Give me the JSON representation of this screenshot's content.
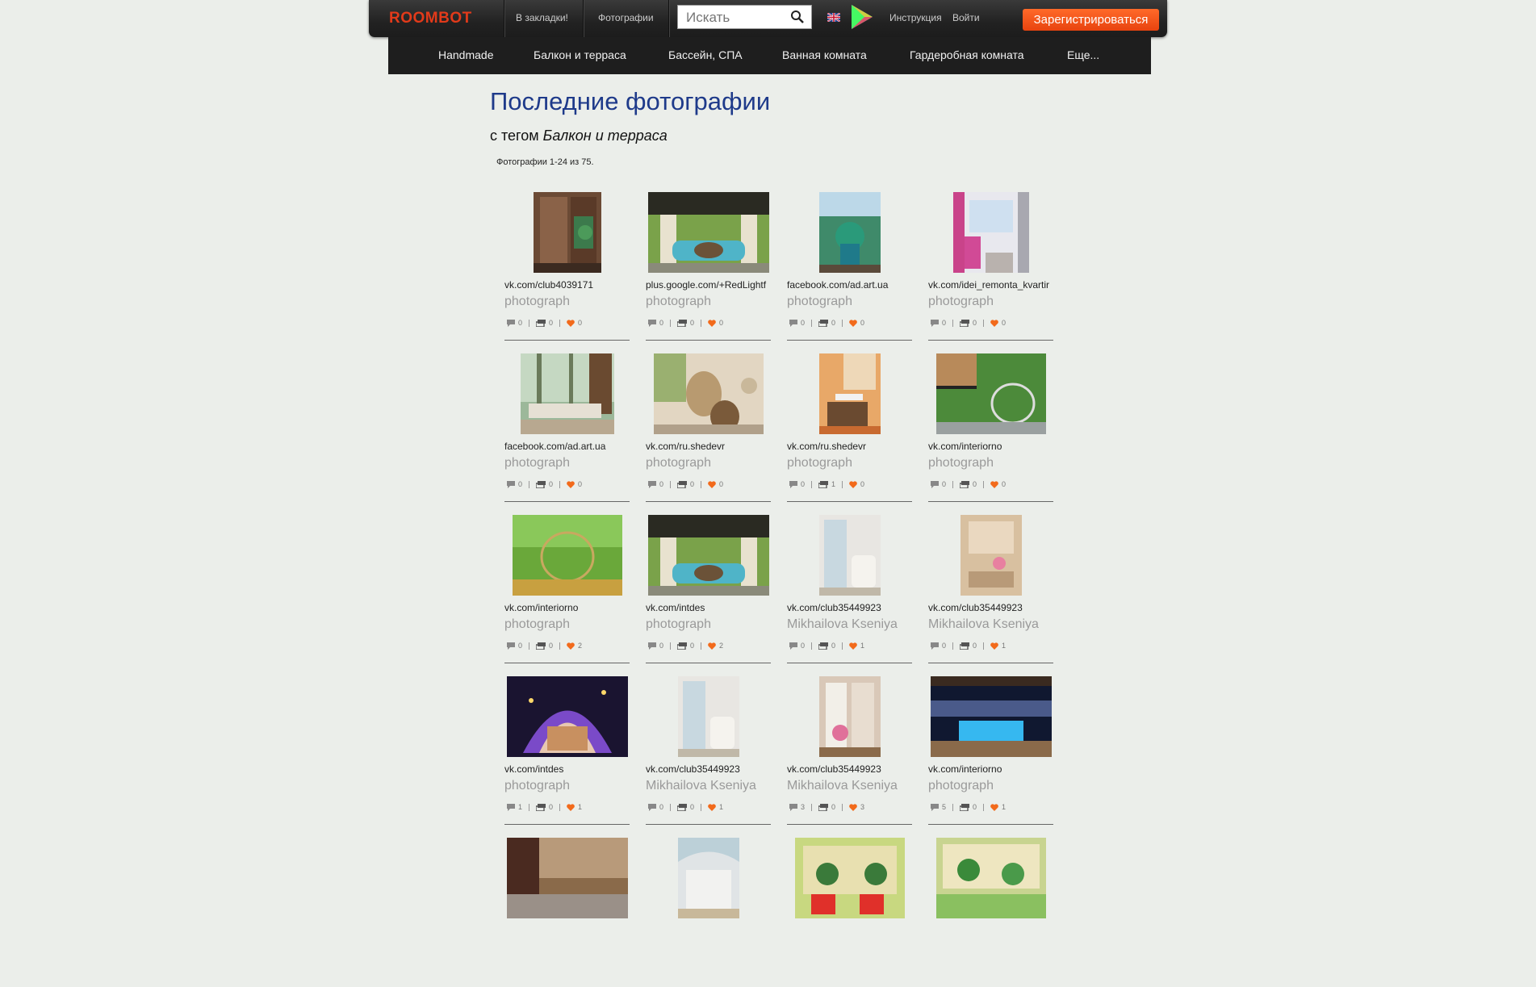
{
  "brand": {
    "logo": "ROOMBOT",
    "accent": "#e23a1a",
    "register_color": "#f15a22"
  },
  "topbar": {
    "bookmarks": "В закладки!",
    "photos": "Фотографии",
    "search_placeholder": "Искать",
    "instructions": "Инструкция",
    "login": "Войти",
    "register": "Зарегистрироваться"
  },
  "categories": [
    "Handmade",
    "Балкон и терраса",
    "Бассейн, СПА",
    "Ванная комната",
    "Гардеробная комната",
    "Еще..."
  ],
  "heading": {
    "title": "Последние фотографии",
    "tag_prefix": "с тегом",
    "tag": "Балкон и терраса",
    "count": "Фотографии 1-24 из 75."
  },
  "photos": [
    {
      "source": "vk.com/club4039171",
      "author": "photograph",
      "comments": "0",
      "collections": "0",
      "likes": "0",
      "scene": "wood-door"
    },
    {
      "source": "plus.google.com/+RedLightf",
      "author": "photograph",
      "comments": "0",
      "collections": "0",
      "likes": "0",
      "scene": "gazebo"
    },
    {
      "source": "facebook.com/ad.art.ua",
      "author": "photograph",
      "comments": "0",
      "collections": "0",
      "likes": "0",
      "scene": "green-room"
    },
    {
      "source": "vk.com/idei_remonta_kvartir",
      "author": "photograph",
      "comments": "0",
      "collections": "0",
      "likes": "0",
      "scene": "pink-balcony"
    },
    {
      "source": "facebook.com/ad.art.ua",
      "author": "photograph",
      "comments": "0",
      "collections": "0",
      "likes": "0",
      "scene": "forest-bed"
    },
    {
      "source": "vk.com/ru.shedevr",
      "author": "photograph",
      "comments": "0",
      "collections": "0",
      "likes": "0",
      "scene": "hanging-chair"
    },
    {
      "source": "vk.com/ru.shedevr",
      "author": "photograph",
      "comments": "0",
      "collections": "1",
      "likes": "0",
      "scene": "orange-balcony"
    },
    {
      "source": "vk.com/interiorno",
      "author": "photograph",
      "comments": "0",
      "collections": "0",
      "likes": "0",
      "scene": "terrace-swing"
    },
    {
      "source": "vk.com/interiorno",
      "author": "photograph",
      "comments": "0",
      "collections": "0",
      "likes": "2",
      "scene": "garden-swing"
    },
    {
      "source": "vk.com/intdes",
      "author": "photograph",
      "comments": "0",
      "collections": "0",
      "likes": "2",
      "scene": "gazebo"
    },
    {
      "source": "vk.com/club35449923",
      "author": "Mikhailova Kseniya",
      "comments": "0",
      "collections": "0",
      "likes": "1",
      "scene": "white-balcony"
    },
    {
      "source": "vk.com/club35449923",
      "author": "Mikhailova Kseniya",
      "comments": "0",
      "collections": "0",
      "likes": "1",
      "scene": "beige-balcony"
    },
    {
      "source": "vk.com/intdes",
      "author": "photograph",
      "comments": "1",
      "collections": "0",
      "likes": "1",
      "scene": "night-tent"
    },
    {
      "source": "vk.com/club35449923",
      "author": "Mikhailova Kseniya",
      "comments": "0",
      "collections": "0",
      "likes": "1",
      "scene": "white-balcony"
    },
    {
      "source": "vk.com/club35449923",
      "author": "Mikhailova Kseniya",
      "comments": "3",
      "collections": "0",
      "likes": "3",
      "scene": "pink-balcony2"
    },
    {
      "source": "vk.com/interiorno",
      "author": "photograph",
      "comments": "5",
      "collections": "0",
      "likes": "1",
      "scene": "pool-night"
    },
    {
      "source": "",
      "author": "",
      "comments": "",
      "collections": "",
      "likes": "",
      "scene": "autumn-patio"
    },
    {
      "source": "",
      "author": "",
      "comments": "",
      "collections": "",
      "likes": "",
      "scene": "glass-balcony"
    },
    {
      "source": "",
      "author": "",
      "comments": "",
      "collections": "",
      "likes": "",
      "scene": "red-chairs"
    },
    {
      "source": "",
      "author": "",
      "comments": "",
      "collections": "",
      "likes": "",
      "scene": "green-balcony"
    }
  ]
}
